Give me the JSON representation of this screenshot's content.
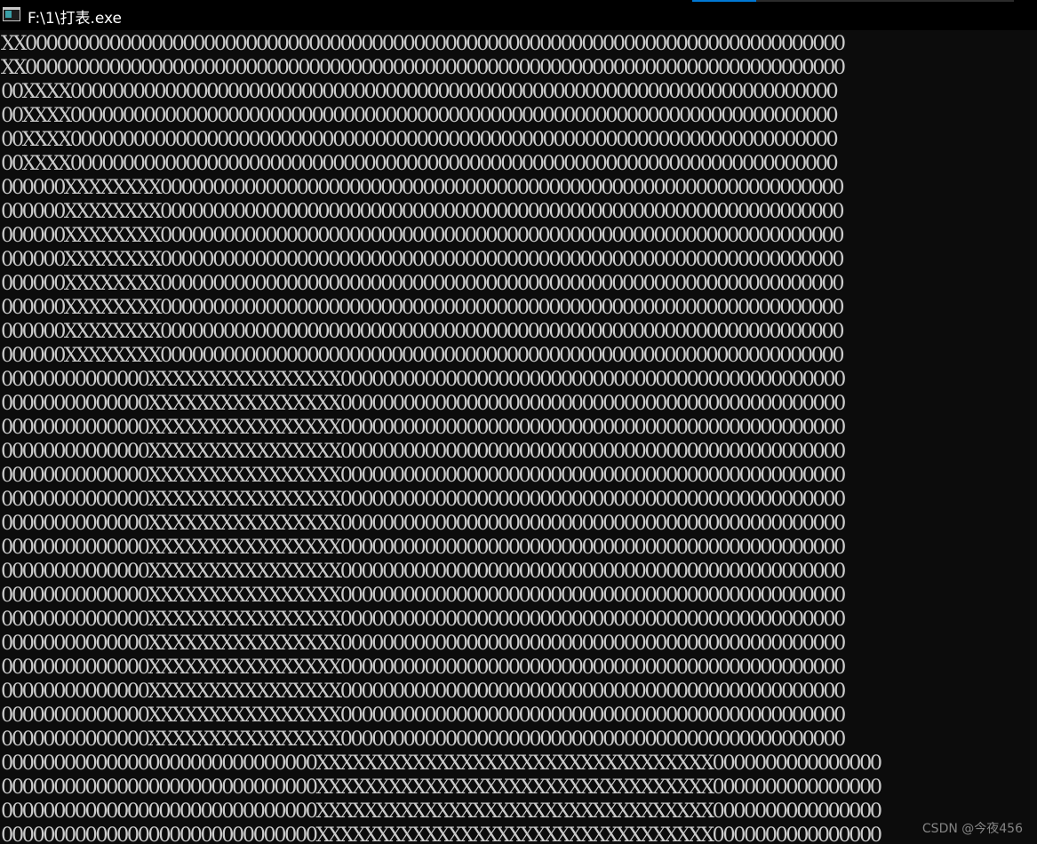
{
  "window": {
    "title": "F:\\1\\打表.exe",
    "icon": "console-app-icon"
  },
  "console": {
    "lines": [
      "XX000000000000000000000000000000000000000000000000000000000000000000000000000000",
      "XX000000000000000000000000000000000000000000000000000000000000000000000000000000",
      "00XXXX0000000000000000000000000000000000000000000000000000000000000000000000000",
      "00XXXX0000000000000000000000000000000000000000000000000000000000000000000000000",
      "00XXXX0000000000000000000000000000000000000000000000000000000000000000000000000",
      "00XXXX0000000000000000000000000000000000000000000000000000000000000000000000000",
      "000000XXXXXXXX00000000000000000000000000000000000000000000000000000000000000000",
      "000000XXXXXXXX00000000000000000000000000000000000000000000000000000000000000000",
      "000000XXXXXXXX00000000000000000000000000000000000000000000000000000000000000000",
      "000000XXXXXXXX00000000000000000000000000000000000000000000000000000000000000000",
      "000000XXXXXXXX00000000000000000000000000000000000000000000000000000000000000000",
      "000000XXXXXXXX00000000000000000000000000000000000000000000000000000000000000000",
      "000000XXXXXXXX00000000000000000000000000000000000000000000000000000000000000000",
      "000000XXXXXXXX00000000000000000000000000000000000000000000000000000000000000000",
      "00000000000000XXXXXXXXXXXXXXXX000000000000000000000000000000000000000000000000",
      "00000000000000XXXXXXXXXXXXXXXX000000000000000000000000000000000000000000000000",
      "00000000000000XXXXXXXXXXXXXXXX000000000000000000000000000000000000000000000000",
      "00000000000000XXXXXXXXXXXXXXXX000000000000000000000000000000000000000000000000",
      "00000000000000XXXXXXXXXXXXXXXX000000000000000000000000000000000000000000000000",
      "00000000000000XXXXXXXXXXXXXXXX000000000000000000000000000000000000000000000000",
      "00000000000000XXXXXXXXXXXXXXXX000000000000000000000000000000000000000000000000",
      "00000000000000XXXXXXXXXXXXXXXX000000000000000000000000000000000000000000000000",
      "00000000000000XXXXXXXXXXXXXXXX000000000000000000000000000000000000000000000000",
      "00000000000000XXXXXXXXXXXXXXXX000000000000000000000000000000000000000000000000",
      "00000000000000XXXXXXXXXXXXXXXX000000000000000000000000000000000000000000000000",
      "00000000000000XXXXXXXXXXXXXXXX000000000000000000000000000000000000000000000000",
      "00000000000000XXXXXXXXXXXXXXXX000000000000000000000000000000000000000000000000",
      "00000000000000XXXXXXXXXXXXXXXX000000000000000000000000000000000000000000000000",
      "00000000000000XXXXXXXXXXXXXXXX000000000000000000000000000000000000000000000000",
      "00000000000000XXXXXXXXXXXXXXXX000000000000000000000000000000000000000000000000",
      "000000000000000000000000000000XXXXXXXXXXXXXXXXXXXXXXXXXXXXXXXXX0000000000000000",
      "000000000000000000000000000000XXXXXXXXXXXXXXXXXXXXXXXXXXXXXXXXX0000000000000000",
      "000000000000000000000000000000XXXXXXXXXXXXXXXXXXXXXXXXXXXXXXXXX0000000000000000",
      "000000000000000000000000000000XXXXXXXXXXXXXXXXXXXXXXXXXXXXXXXXX0000000000000000"
    ]
  },
  "watermark": "CSDN @今夜456",
  "colors": {
    "background": "#0c0c0c",
    "titlebar": "#000000",
    "text": "#cccccc",
    "accent": "#0078d4"
  }
}
